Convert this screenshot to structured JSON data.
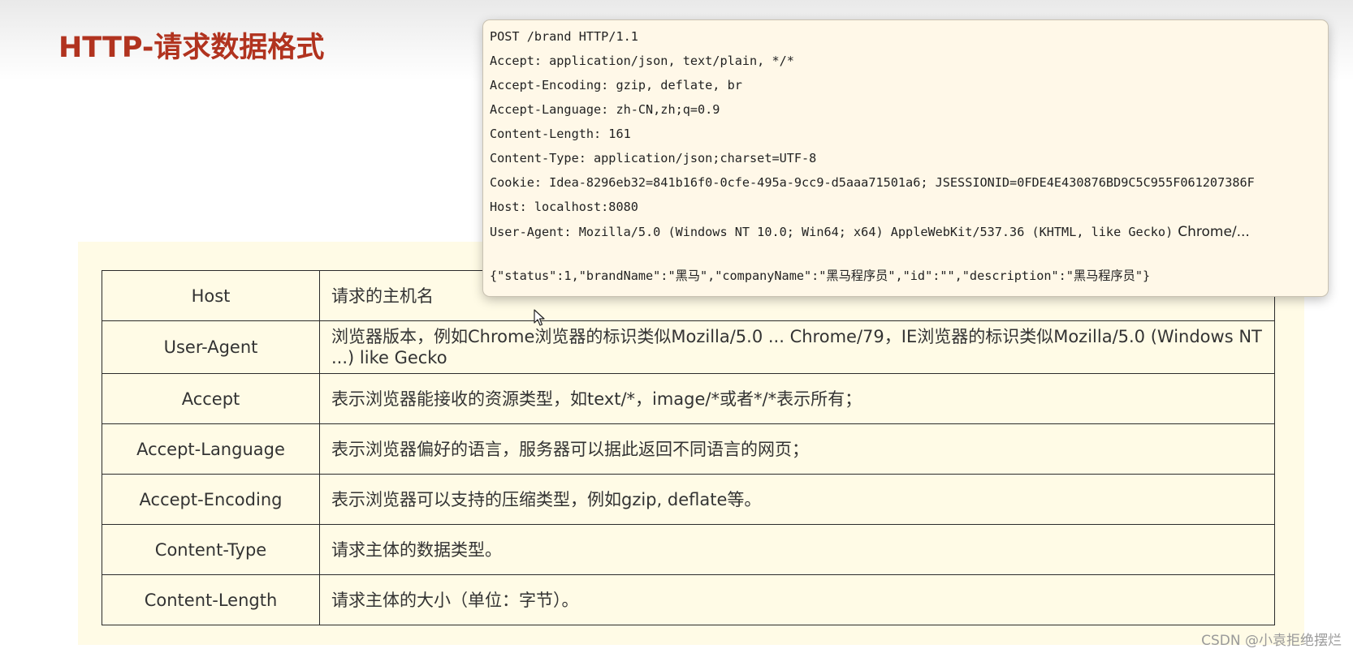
{
  "slide": {
    "title": "HTTP-请求数据格式"
  },
  "header_table": {
    "rows": [
      {
        "name": "Host",
        "description": "请求的主机名"
      },
      {
        "name": "User-Agent",
        "description": "浏览器版本，例如Chrome浏览器的标识类似Mozilla/5.0 ... Chrome/79，IE浏览器的标识类似Mozilla/5.0 (Windows NT ...) like Gecko"
      },
      {
        "name": "Accept",
        "description": "表示浏览器能接收的资源类型，如text/*，image/*或者*/*表示所有；"
      },
      {
        "name": "Accept-Language",
        "description": "表示浏览器偏好的语言，服务器可以据此返回不同语言的网页；"
      },
      {
        "name": "Accept-Encoding",
        "description": "表示浏览器可以支持的压缩类型，例如gzip, deflate等。"
      },
      {
        "name": "Content-Type",
        "description": "请求主体的数据类型。"
      },
      {
        "name": "Content-Length",
        "description": "请求主体的大小（单位：字节）。"
      }
    ]
  },
  "request_example": {
    "lines": [
      "POST /brand HTTP/1.1",
      "Accept: application/json, text/plain, */*",
      "Accept-Encoding: gzip, deflate, br",
      "Accept-Language: zh-CN,zh;q=0.9",
      "Content-Length: 161",
      "Content-Type: application/json;charset=UTF-8",
      "Cookie: Idea-8296eb32=841b16f0-0cfe-495a-9cc9-d5aaa71501a6; JSESSIONID=0FDE4E430876BD9C5C955F061207386F",
      "Host: localhost:8080",
      "User-Agent: Mozilla/5.0 (Windows NT 10.0; Win64; x64) AppleWebKit/537.36 (KHTML, like Gecko)"
    ],
    "user_agent_suffix": "Chrome/...",
    "body": "{\"status\":1,\"brandName\":\"黑马\",\"companyName\":\"黑马程序员\",\"id\":\"\",\"description\":\"黑马程序员\"}"
  },
  "watermark": "CSDN @小袁拒绝摆烂",
  "colors": {
    "title": "#b1331f",
    "panel_background": "#fffbe6",
    "popup_background": "#fff8e8"
  },
  "icons": {
    "cursor": "mouse-pointer-icon"
  }
}
